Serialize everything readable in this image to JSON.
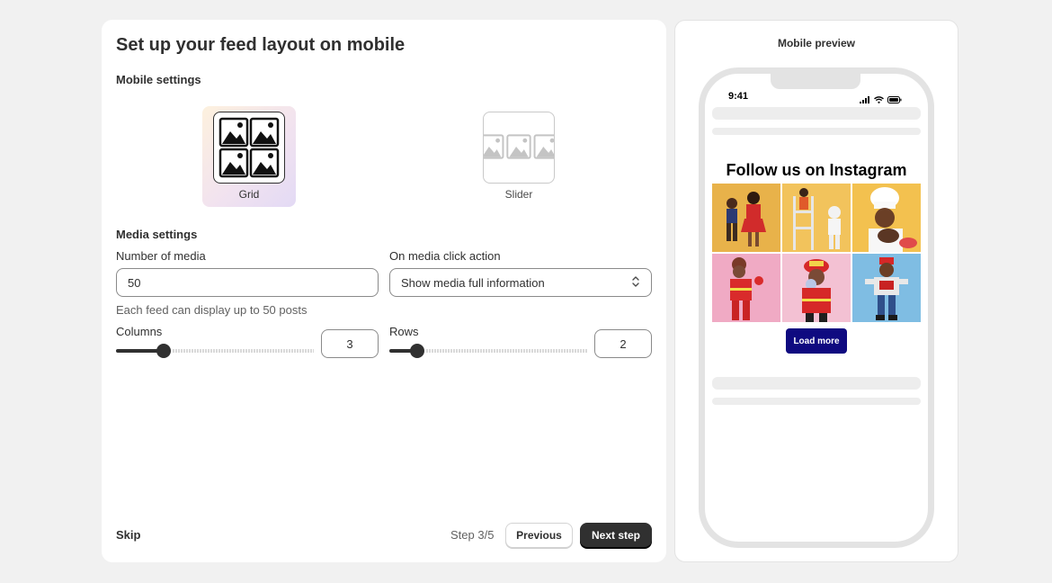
{
  "page": {
    "title": "Set up your feed layout on mobile"
  },
  "mobile_settings": {
    "heading": "Mobile settings",
    "options": [
      {
        "label": "Grid",
        "selected": true
      },
      {
        "label": "Slider",
        "selected": false
      }
    ]
  },
  "media_settings": {
    "heading": "Media settings",
    "number_of_media": {
      "label": "Number of media",
      "value": "50",
      "help": "Each feed can display up to 50 posts"
    },
    "click_action": {
      "label": "On media click action",
      "value": "Show media full information"
    },
    "columns": {
      "label": "Columns",
      "value": "3",
      "slider_fraction": 0.24
    },
    "rows": {
      "label": "Rows",
      "value": "2",
      "slider_fraction": 0.14
    }
  },
  "footer": {
    "skip_label": "Skip",
    "step_text": "Step 3/5",
    "previous_label": "Previous",
    "next_label": "Next step"
  },
  "preview": {
    "title": "Mobile preview",
    "status_time": "9:41",
    "feed_title": "Follow us on Instagram",
    "load_more_label": "Load more",
    "tiles": [
      {
        "name": "cheerleader-kids-photo",
        "bg": "#e8b24a"
      },
      {
        "name": "astronaut-kids-photo",
        "bg": "#f2c35c"
      },
      {
        "name": "chef-kid-photo",
        "bg": "#f3c14f"
      },
      {
        "name": "firefighter-kid-pink-photo",
        "bg": "#f0aac4"
      },
      {
        "name": "firefighter-kid-photo",
        "bg": "#f3c1d3"
      },
      {
        "name": "kid-blue-wall-photo",
        "bg": "#7fbde3"
      }
    ]
  },
  "colors": {
    "accent_dark": "#303030",
    "load_more": "#0f0a80",
    "page_bg": "#f1f1f1"
  }
}
